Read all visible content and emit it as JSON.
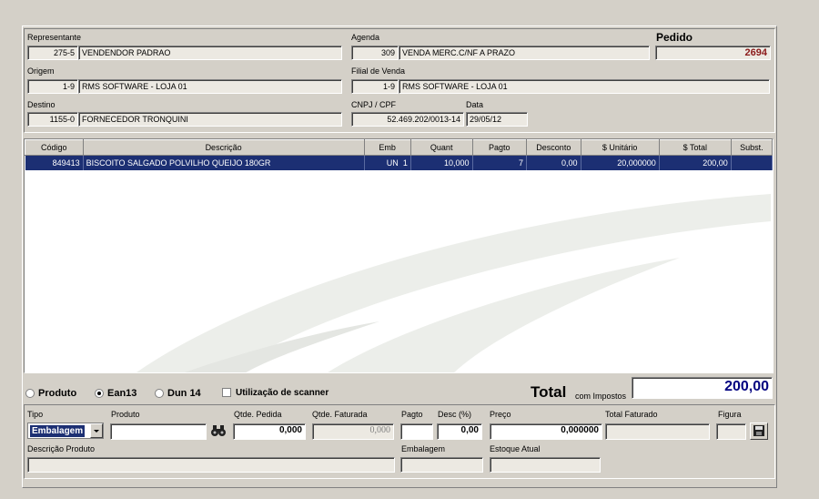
{
  "header": {
    "representante": {
      "label": "Representante",
      "code": "275-5",
      "name": "VENDENDOR PADRAO"
    },
    "agenda": {
      "label": "Agenda",
      "code": "309",
      "name": "VENDA MERC.C/NF A PRAZO"
    },
    "pedido": {
      "label": "Pedido",
      "value": "2694"
    },
    "origem": {
      "label": "Origem",
      "code": "1-9",
      "name": "RMS SOFTWARE - LOJA 01"
    },
    "filial": {
      "label": "Filial de Venda",
      "code": "1-9",
      "name": "RMS SOFTWARE - LOJA 01"
    },
    "destino": {
      "label": "Destino",
      "code": "1155-0",
      "name": "FORNECEDOR TRONQUINI"
    },
    "cnpj": {
      "label": "CNPJ / CPF",
      "value": "52.469.202/0013-14"
    },
    "data": {
      "label": "Data",
      "value": "29/05/12"
    }
  },
  "grid": {
    "columns": [
      "Código",
      "Descrição",
      "Emb",
      "Quant",
      "Pagto",
      "Desconto",
      "$ Unitário",
      "$ Total",
      "Subst."
    ],
    "rows": [
      {
        "codigo": "849413",
        "descricao": "BISCOITO SALGADO POLVILHO QUEIJO 180GR",
        "emb": "UN",
        "emb_qty": "1",
        "quant": "10,000",
        "pagto": "7",
        "desconto": "0,00",
        "unitario": "20,000000",
        "total": "200,00",
        "subst": ""
      }
    ]
  },
  "options": {
    "produto": "Produto",
    "ean13": "Ean13",
    "dun14": "Dun 14",
    "scanner": "Utilização de scanner",
    "selected": "Ean13"
  },
  "total": {
    "label": "Total",
    "suffix": "com Impostos",
    "value": "200,00"
  },
  "form": {
    "tipo": {
      "label": "Tipo",
      "value": "Embalagem"
    },
    "produto": {
      "label": "Produto",
      "value": ""
    },
    "qtde_pedida": {
      "label": "Qtde. Pedida",
      "value": "0,000"
    },
    "qtde_faturada": {
      "label": "Qtde. Faturada",
      "value": "0,000"
    },
    "pagto": {
      "label": "Pagto",
      "value": ""
    },
    "desc": {
      "label": "Desc (%)",
      "value": "0,00"
    },
    "preco": {
      "label": "Preço",
      "value": "0,000000"
    },
    "total_faturado": {
      "label": "Total Faturado",
      "value": ""
    },
    "figura": {
      "label": "Figura",
      "value": ""
    },
    "descricao_produto": {
      "label": "Descrição Produto",
      "value": ""
    },
    "embalagem": {
      "label": "Embalagem",
      "value": ""
    },
    "estoque": {
      "label": "Estoque Atual",
      "value": ""
    }
  },
  "icons": {
    "search": "binoculars-icon",
    "save": "floppy-disk-icon",
    "dropdown": "chevron-down-icon"
  },
  "colors": {
    "selection": "#1c2f73",
    "pedido": "#8b1a1a",
    "total": "#000080"
  }
}
